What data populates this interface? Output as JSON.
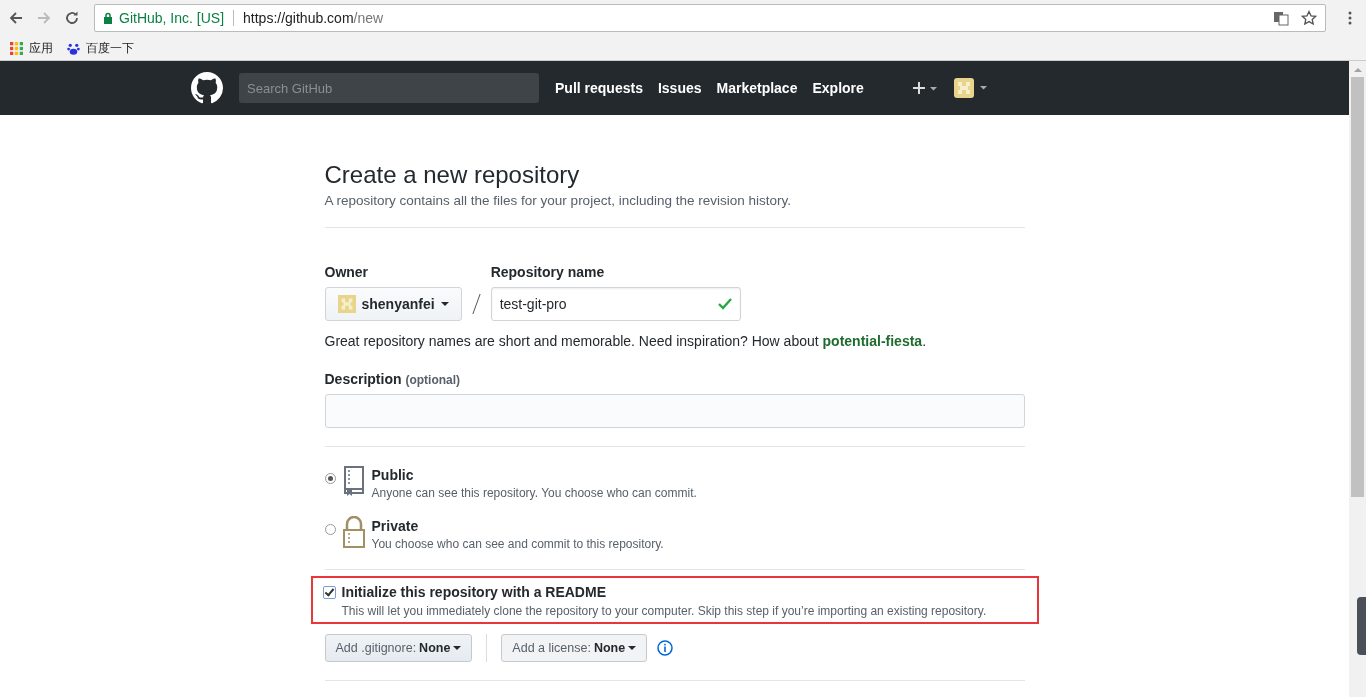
{
  "browser": {
    "site_label": "GitHub, Inc. [US]",
    "url_origin": "https://github.com",
    "url_path": "/new",
    "bookmarks": [
      {
        "label": "应用",
        "kind": "apps"
      },
      {
        "label": "百度一下",
        "kind": "baidu"
      }
    ]
  },
  "header": {
    "search": {
      "placeholder": "Search GitHub"
    },
    "nav": [
      {
        "label": "Pull requests"
      },
      {
        "label": "Issues"
      },
      {
        "label": "Marketplace"
      },
      {
        "label": "Explore"
      }
    ]
  },
  "form": {
    "title": "Create a new repository",
    "subtitle": "A repository contains all the files for your project, including the revision history.",
    "owner_label": "Owner",
    "owner": "shenyanfei",
    "name_label": "Repository name",
    "name_value": "test-git-pro",
    "name_valid": true,
    "hint": "Great repository names are short and memorable. Need inspiration? How about",
    "suggestion": "potential-fiesta",
    "hint_end": ".",
    "description_label": "Description",
    "description_note": "(optional)",
    "visibility": [
      {
        "kind": "public",
        "label": "Public",
        "description": "Anyone can see this repository. You choose who can commit.",
        "selected": true
      },
      {
        "kind": "private",
        "label": "Private",
        "description": "You choose who can see and commit to this repository.",
        "selected": false
      }
    ],
    "readme": {
      "label": "Initialize this repository with a README",
      "description": "This will let you immediately clone the repository to your computer. Skip this step if you’re importing an existing repository.",
      "checked": true,
      "highlighted": true
    },
    "gitignore": {
      "label": "Add .gitignore:",
      "value": "None"
    },
    "license": {
      "label": "Add a license:",
      "value": "None"
    }
  }
}
